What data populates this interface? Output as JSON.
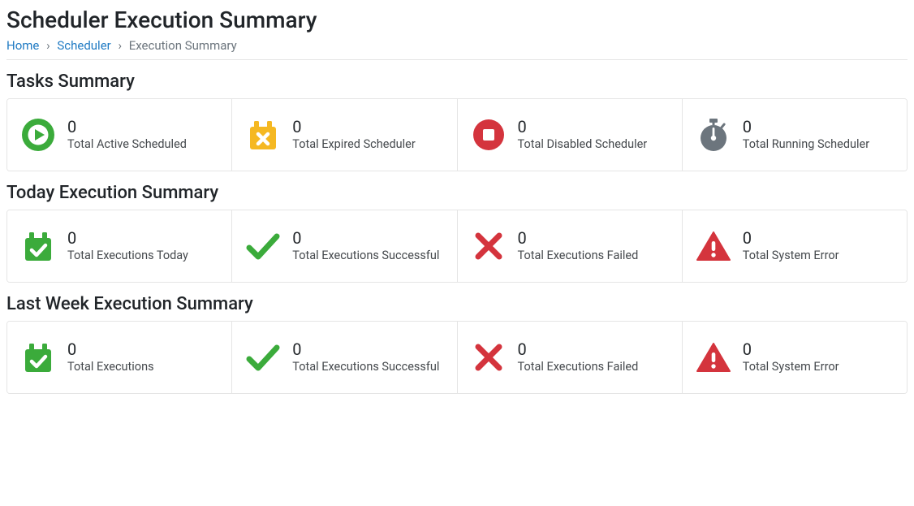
{
  "page": {
    "title": "Scheduler Execution Summary"
  },
  "breadcrumb": {
    "home": "Home",
    "scheduler": "Scheduler",
    "current": "Execution Summary"
  },
  "colors": {
    "green": "#3bab3b",
    "yellow": "#f5b822",
    "red": "#d4343d",
    "gray": "#6c757d",
    "link": "#1f7ac3"
  },
  "sections": {
    "tasks": {
      "title": "Tasks Summary",
      "cards": [
        {
          "icon": "play-circle-icon",
          "value": "0",
          "label": "Total Active Scheduled"
        },
        {
          "icon": "calendar-x-icon",
          "value": "0",
          "label": "Total Expired Scheduler"
        },
        {
          "icon": "stop-circle-icon",
          "value": "0",
          "label": "Total Disabled Scheduler"
        },
        {
          "icon": "stopwatch-icon",
          "value": "0",
          "label": "Total Running Scheduler"
        }
      ]
    },
    "today": {
      "title": "Today Execution Summary",
      "cards": [
        {
          "icon": "calendar-check-icon",
          "value": "0",
          "label": "Total Executions Today"
        },
        {
          "icon": "check-icon",
          "value": "0",
          "label": "Total Executions Successful"
        },
        {
          "icon": "x-icon",
          "value": "0",
          "label": "Total Executions Failed"
        },
        {
          "icon": "warning-icon",
          "value": "0",
          "label": "Total System Error"
        }
      ]
    },
    "lastweek": {
      "title": "Last Week Execution Summary",
      "cards": [
        {
          "icon": "calendar-check-icon",
          "value": "0",
          "label": "Total Executions"
        },
        {
          "icon": "check-icon",
          "value": "0",
          "label": "Total Executions Successful"
        },
        {
          "icon": "x-icon",
          "value": "0",
          "label": "Total Executions Failed"
        },
        {
          "icon": "warning-icon",
          "value": "0",
          "label": "Total System Error"
        }
      ]
    }
  }
}
